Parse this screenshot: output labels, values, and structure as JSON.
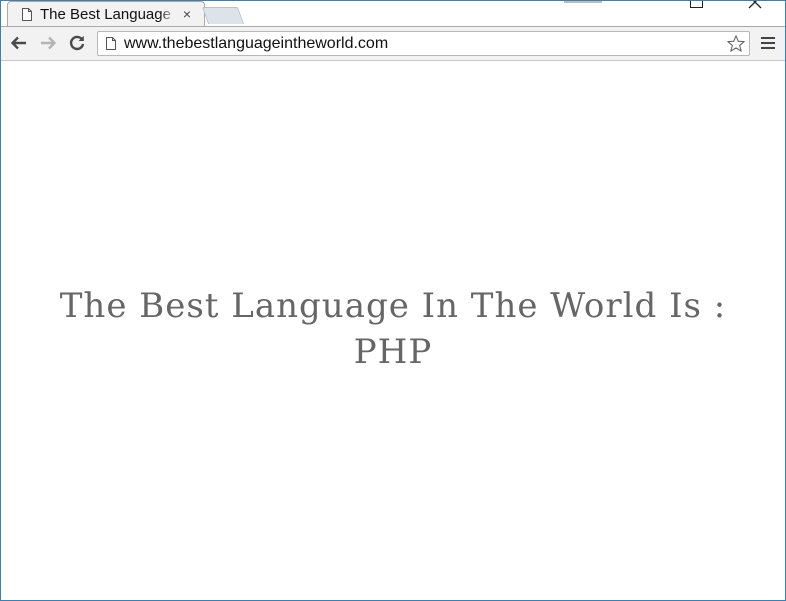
{
  "tab": {
    "title": "The Best Language In The World",
    "icon": "page-icon",
    "close": "×"
  },
  "address_bar": {
    "url": "www.thebestlanguageintheworld.com"
  },
  "page": {
    "headline_line1": "The Best Language In The World Is :",
    "headline_line2": "PHP"
  },
  "colors": {
    "window_border": "#3c7fb1",
    "toolbar_bg": "#f2f2f2",
    "headline_text": "#666666"
  }
}
